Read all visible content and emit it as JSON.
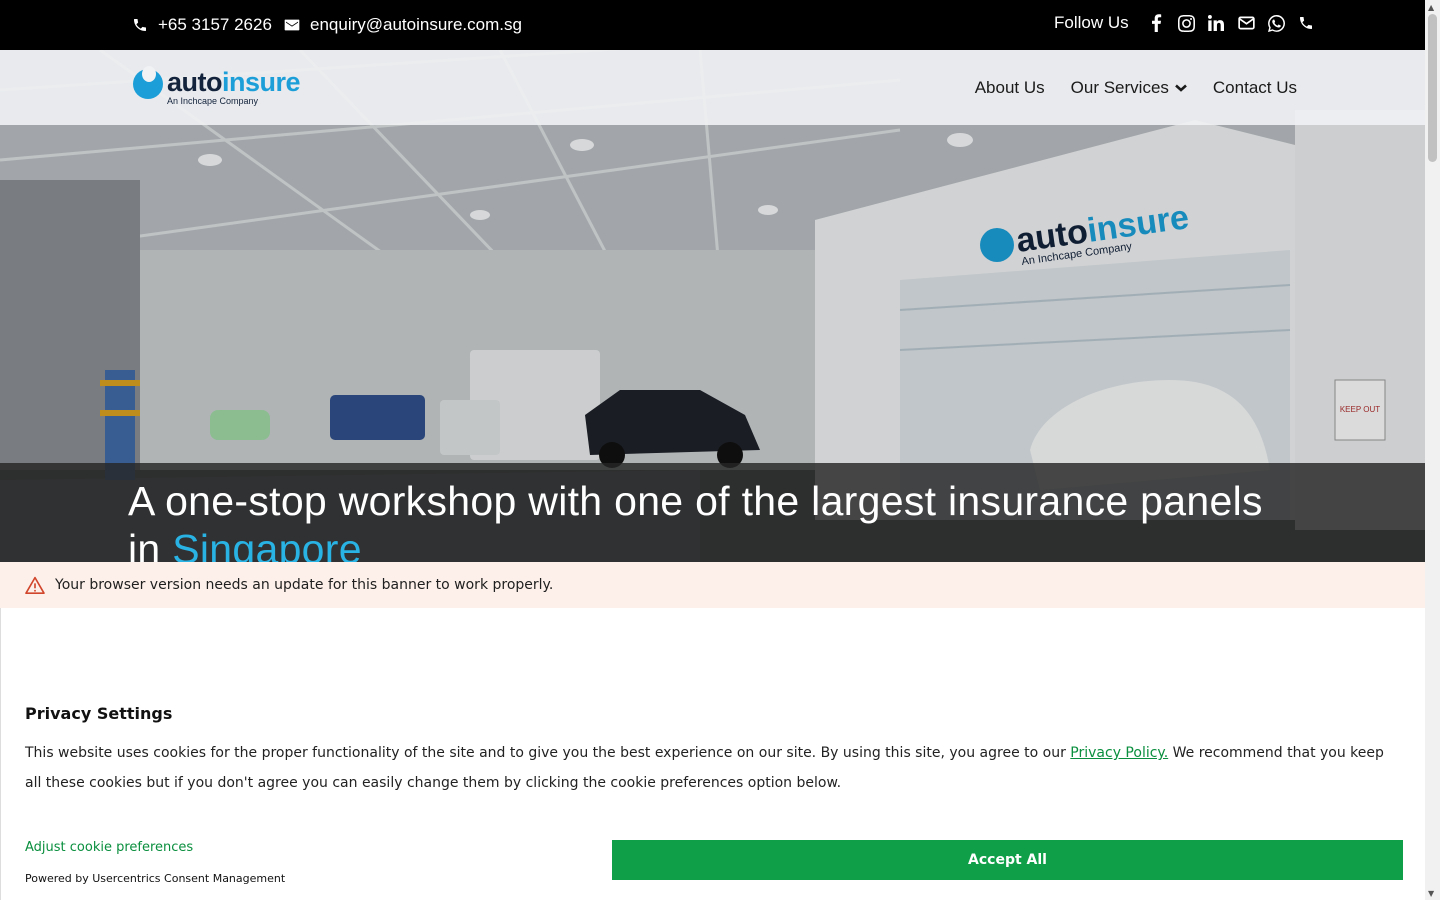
{
  "topbar": {
    "phone": "+65 3157 2626",
    "email": "enquiry@autoinsure.com.sg",
    "follow_label": "Follow Us",
    "social_icons": [
      "facebook-icon",
      "instagram-icon",
      "linkedin-icon",
      "mail-icon",
      "whatsapp-icon",
      "phone-icon"
    ]
  },
  "header": {
    "logo_part1": "auto",
    "logo_part2": "insure",
    "logo_tagline": "An Inchcape Company",
    "nav": {
      "about": "About Us",
      "services": "Our Services",
      "contact": "Contact Us"
    }
  },
  "hero": {
    "heading_main": "A one-stop workshop with one of the largest insurance panels in ",
    "heading_highlight": "Singapore",
    "sign_part1": "auto",
    "sign_part2": "insure",
    "sign_tagline": "An Inchcape Company",
    "door_sign": "KEEP OUT"
  },
  "banner_warning": {
    "text": "Your browser version needs an update for this banner to work properly."
  },
  "cookie": {
    "title": "Privacy Settings",
    "description_before": "This website uses cookies for the proper functionality of the site and to give you the best experience on our site. By using this site, you agree to our ",
    "policy_link": "Privacy Policy.",
    "description_after": " We recommend that you keep all these cookies but if you don't agree you can easily change them by clicking the cookie preferences option below.",
    "adjust_link": "Adjust cookie preferences",
    "powered_by": "Powered by Usercentrics Consent Management",
    "accept_label": "Accept All"
  },
  "colors": {
    "accent_blue": "#29b2e4",
    "accept_green": "#0e9f48",
    "link_green": "#0a8f3e",
    "warning_bg": "#fdf0ea"
  }
}
